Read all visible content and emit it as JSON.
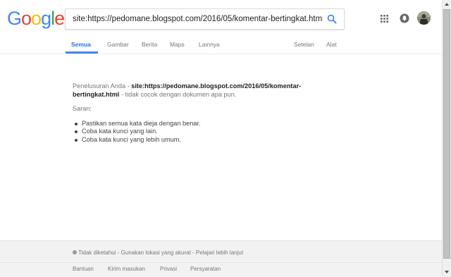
{
  "logo": {
    "letters": [
      "G",
      "o",
      "o",
      "g",
      "l",
      "e"
    ],
    "colors": [
      "#4285F4",
      "#EA4335",
      "#FBBC05",
      "#4285F4",
      "#34A853",
      "#EA4335"
    ]
  },
  "search": {
    "value": "site:https://pedomane.blogspot.com/2016/05/komentar-bertingkat.html",
    "icon": "search-icon"
  },
  "header_icons": {
    "apps": "apps-grid-icon",
    "notifications": "notifications-icon",
    "avatar": "avatar"
  },
  "tabs": [
    {
      "label": "Semua",
      "active": true
    },
    {
      "label": "Gambar",
      "active": false
    },
    {
      "label": "Berita",
      "active": false
    },
    {
      "label": "Maps",
      "active": false
    },
    {
      "label": "Lainnya",
      "active": false
    },
    {
      "label": "Setelan",
      "active": false
    },
    {
      "label": "Alat",
      "active": false
    }
  ],
  "results": {
    "prefix": "Penelusuran Anda - ",
    "query": "site:https://pedomane.blogspot.com/2016/05/komentar-bertingkat.html",
    "suffix": " - tidak cocok dengan dokumen apa pun.",
    "suggestions_label": "Saran:",
    "suggestions": [
      "Pastikan semua kata dieja dengan benar.",
      "Coba kata kunci yang lain.",
      "Coba kata kunci yang lebih umum."
    ]
  },
  "footer": {
    "location_status": "Tidak diketahui",
    "location_sep": " - ",
    "precise_location": "Gunakan lokasi yang akurat",
    "learn_more": "Pelajari lebih lanjut",
    "links": [
      "Bantuan",
      "Kirim masukan",
      "Privasi",
      "Persyaratan"
    ]
  },
  "colors": {
    "accent": "#4285f4",
    "active_tab": "#1a73e8",
    "footer_bg": "#f2f2f2"
  }
}
